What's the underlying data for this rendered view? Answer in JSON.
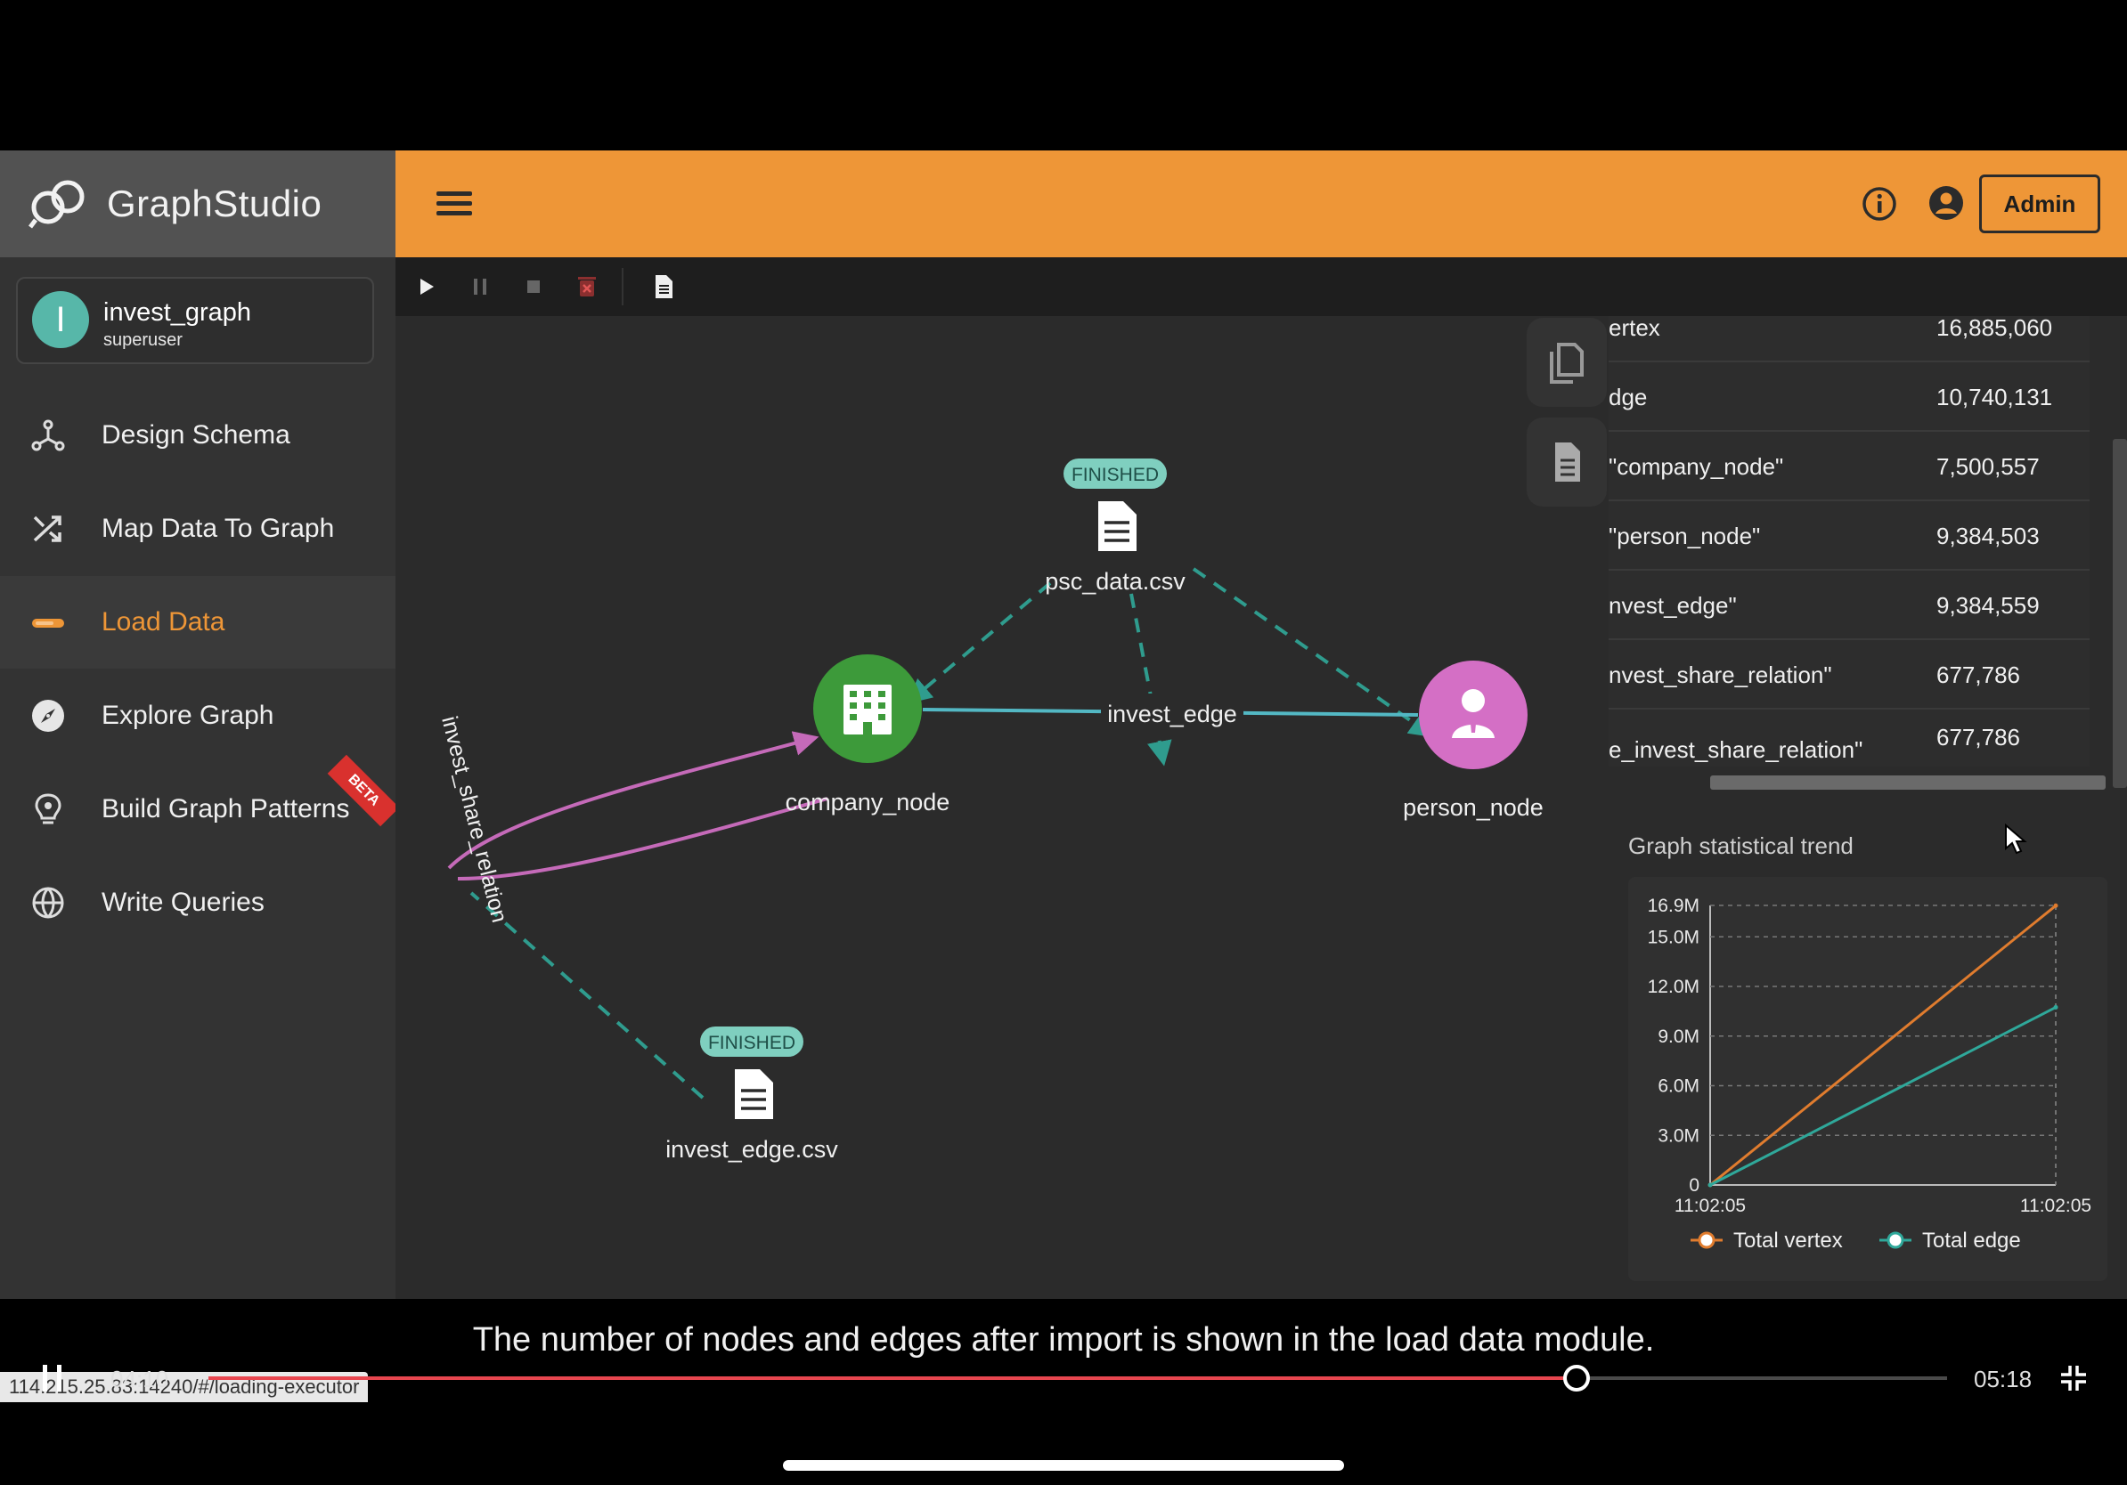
{
  "app": {
    "brand": "GraphStudio",
    "admin_label": "Admin"
  },
  "graph": {
    "name": "invest_graph",
    "role": "superuser",
    "initial": "I"
  },
  "sidebar": {
    "items": [
      {
        "label": "Design Schema",
        "icon": "schema-icon"
      },
      {
        "label": "Map Data To Graph",
        "icon": "shuffle-icon"
      },
      {
        "label": "Load Data",
        "icon": "load-icon",
        "active": true
      },
      {
        "label": "Explore Graph",
        "icon": "compass-icon"
      },
      {
        "label": "Build Graph Patterns",
        "icon": "lightbulb-icon",
        "badge": "BETA"
      },
      {
        "label": "Write Queries",
        "icon": "globe-code-icon"
      }
    ],
    "status_url": "114.215.25.83:14240/#/loading-executor"
  },
  "toolbar": {
    "icons": [
      "play-icon",
      "pause-icon",
      "stop-icon",
      "delete-icon",
      "log-file-icon"
    ]
  },
  "canvas": {
    "files": [
      {
        "name": "psc_data.csv",
        "status": "FINISHED"
      },
      {
        "name": "invest_edge.csv",
        "status": "FINISHED"
      }
    ],
    "nodes": [
      {
        "name": "company_node",
        "color": "#3d9a3a",
        "icon": "building-icon"
      },
      {
        "name": "person_node",
        "color": "#d46fc5",
        "icon": "person-icon"
      }
    ],
    "edges": [
      "invest_edge",
      "invest_share_relation"
    ],
    "colors": {
      "file_edge": "#2f9c8e",
      "invest_edge": "#53b8c4",
      "share_relation": "#c56ab9",
      "badge": "#7fcfbf"
    }
  },
  "stats": {
    "rows": [
      {
        "key": "ertex",
        "value": "16,885,060"
      },
      {
        "key": "dge",
        "value": "10,740,131"
      },
      {
        "key": "\"company_node\"",
        "value": "7,500,557"
      },
      {
        "key": "\"person_node\"",
        "value": "9,384,503"
      },
      {
        "key": "nvest_edge\"",
        "value": "9,384,559"
      },
      {
        "key": "nvest_share_relation\"",
        "value": "677,786"
      },
      {
        "key": "e_invest_share_relation\"",
        "value": "677,786"
      }
    ]
  },
  "trend": {
    "title": "Graph statistical trend"
  },
  "chart_data": {
    "type": "line",
    "x": [
      "11:02:05",
      "11:02:05"
    ],
    "yticks": [
      "0",
      "3.0M",
      "6.0M",
      "9.0M",
      "12.0M",
      "15.0M",
      "16.9M"
    ],
    "ylim": [
      0,
      16900000
    ],
    "series": [
      {
        "name": "Total vertex",
        "color": "#e07c2e",
        "values": [
          0,
          16885060
        ]
      },
      {
        "name": "Total edge",
        "color": "#2fa89a",
        "values": [
          0,
          10740131
        ]
      }
    ]
  },
  "video": {
    "caption": "The number of nodes and edges after import is shown in the load data module.",
    "current_time": "04:10",
    "total_time": "05:18",
    "progress": 0.787
  }
}
